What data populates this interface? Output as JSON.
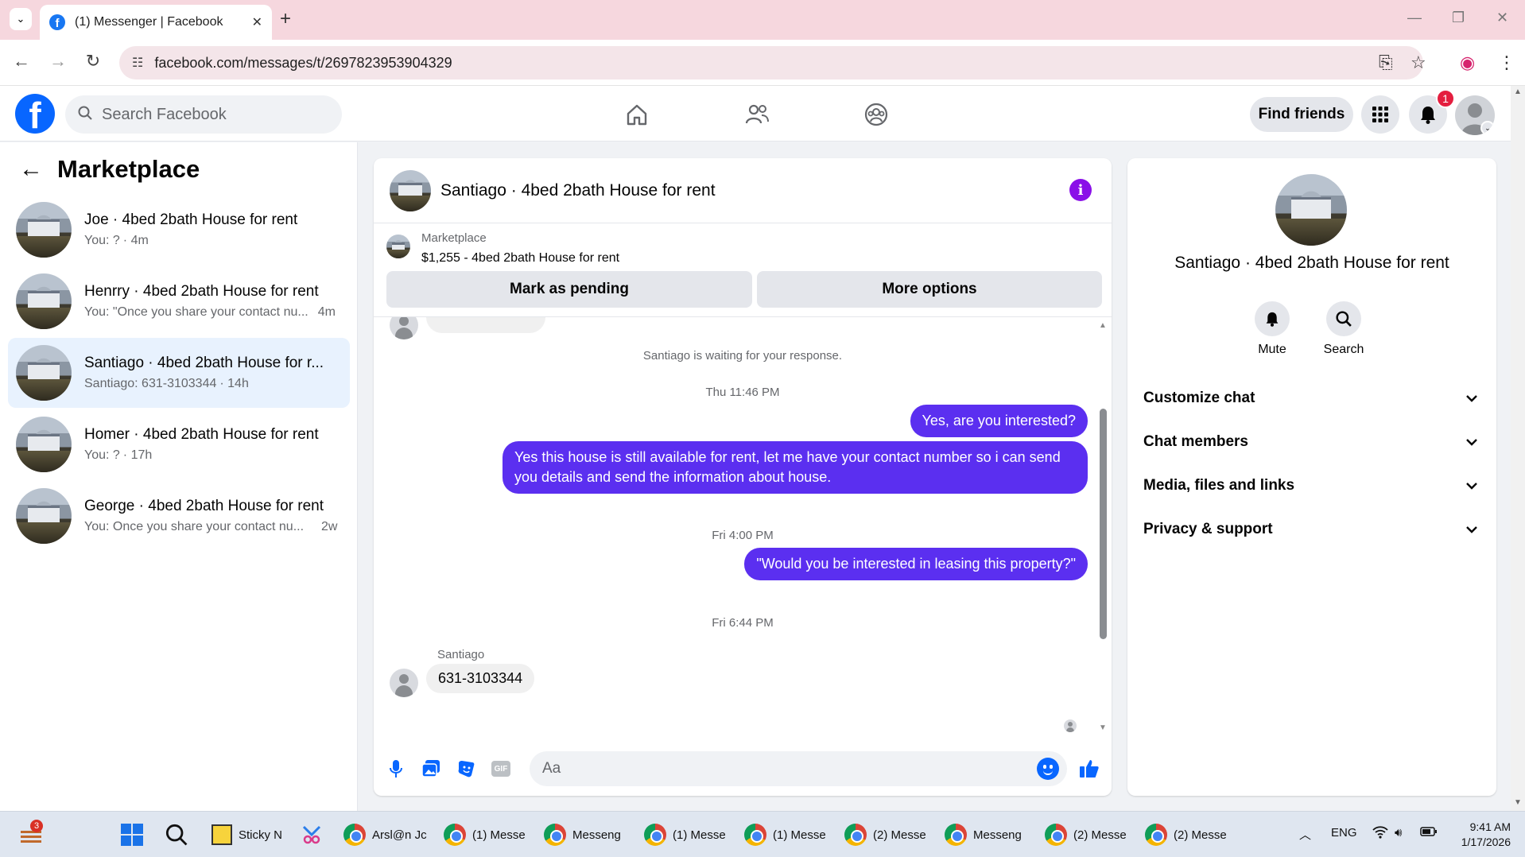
{
  "browser": {
    "tab_title": "(1) Messenger | Facebook",
    "url": "facebook.com/messages/t/2697823953904329"
  },
  "fb_header": {
    "search_placeholder": "Search Facebook",
    "find_friends": "Find friends",
    "notification_count": "1"
  },
  "left_panel": {
    "title": "Marketplace",
    "conversations": [
      {
        "name": "Joe · 4bed 2bath House for rent",
        "preview": "You: ?",
        "time": "· 4m",
        "active": false
      },
      {
        "name": "Henrry · 4bed 2bath House for rent",
        "preview": "You: \"Once you share your contact nu...",
        "time": "4m",
        "active": false
      },
      {
        "name": "Santiago · 4bed 2bath House for r...",
        "preview": "Santiago: 631-3103344",
        "time": "· 14h",
        "active": true
      },
      {
        "name": "Homer · 4bed 2bath House for rent",
        "preview": "You: ?",
        "time": "· 17h",
        "active": false
      },
      {
        "name": "George · 4bed 2bath House for rent",
        "preview": "You: Once you share your contact nu...",
        "time": "2w",
        "active": false
      }
    ]
  },
  "chat": {
    "title": "Santiago · 4bed 2bath House for rent",
    "marketplace_label": "Marketplace",
    "listing": "$1,255 - 4bed 2bath House for rent",
    "btn_pending": "Mark as pending",
    "btn_more": "More options",
    "waiting_notice": "Santiago is waiting for your response.",
    "ts1": "Thu 11:46 PM",
    "msg_out_1": "Yes, are you interested?",
    "msg_out_2": "Yes this house is still available for rent, let me have your contact number so i can send you details and send the information about house.",
    "ts2": "Fri 4:00 PM",
    "msg_out_3": "\"Would you be interested in leasing this property?\"",
    "ts3": "Fri 6:44 PM",
    "sender_name": "Santiago",
    "msg_in_1": "631-3103344",
    "composer_placeholder": "Aa"
  },
  "right_panel": {
    "name": "Santiago · 4bed 2bath House for rent",
    "mute": "Mute",
    "search": "Search",
    "sections": [
      "Customize chat",
      "Chat members",
      "Media, files and links",
      "Privacy & support"
    ]
  },
  "taskbar": {
    "weather_badge": "3",
    "items": [
      "Sticky N",
      "Arsl@n Jc",
      "(1) Messe",
      "Messeng",
      "(1) Messe",
      "(1) Messe",
      "(2) Messe",
      "Messeng",
      "(2) Messe",
      "(2) Messe"
    ],
    "lang": "ENG",
    "time": "9:41 AM",
    "date": "1/17/2026"
  },
  "colors": {
    "accent": "#5b2ff0",
    "fb_blue": "#0866ff",
    "active_conv": "#e8f2fe"
  }
}
